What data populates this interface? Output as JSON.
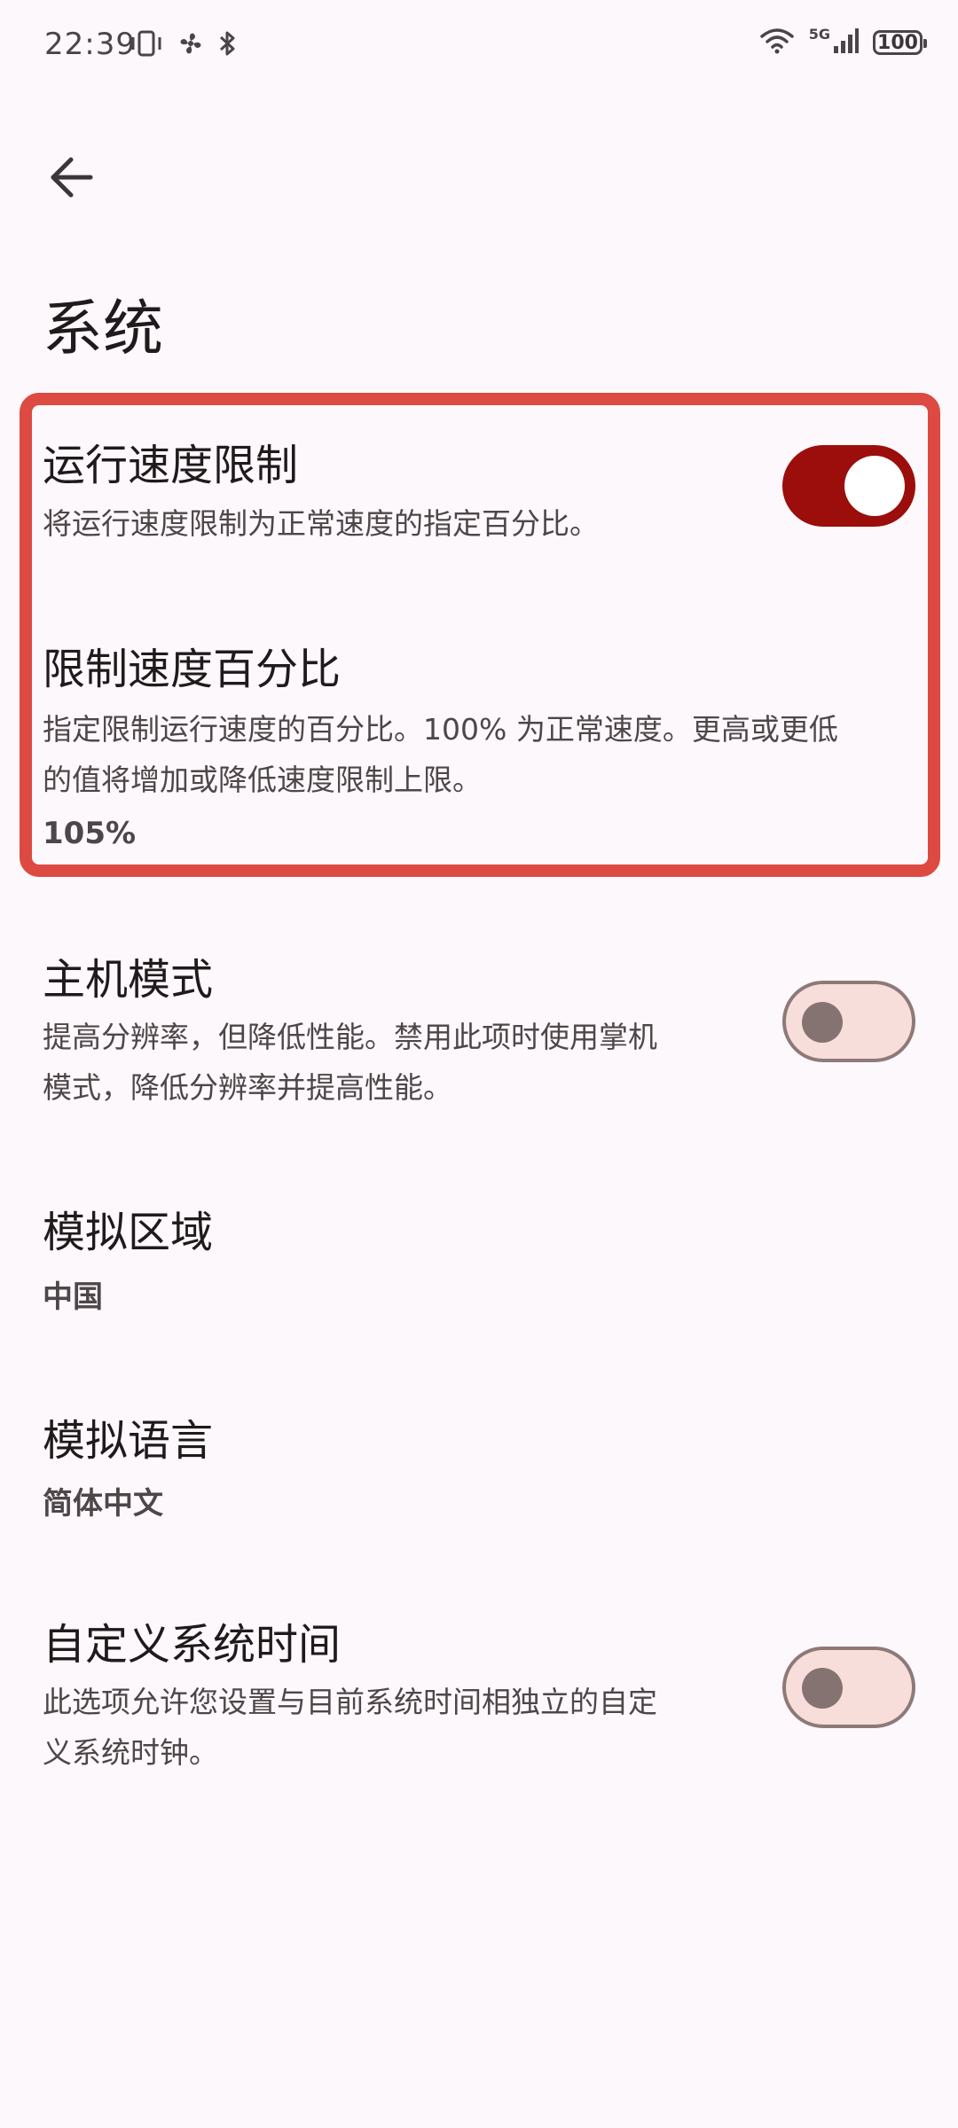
{
  "status_bar": {
    "time": "22:39",
    "network_label": "5G",
    "battery_level": "100",
    "left_icons": [
      "vibrate-icon",
      "fan-icon",
      "bluetooth-icon"
    ],
    "right_icons": [
      "wifi-icon",
      "signal-icon",
      "battery-icon"
    ]
  },
  "header": {
    "back_icon": "arrow-left-icon",
    "title": "系统"
  },
  "settings": {
    "speed_limit": {
      "title": "运行速度限制",
      "description": "将运行速度限制为正常速度的指定百分比。",
      "enabled": true
    },
    "speed_percent": {
      "title": "限制速度百分比",
      "description_line1": "指定限制运行速度的百分比。100% 为正常速度。更高或更低",
      "description_line2": "的值将增加或降低速度限制上限。",
      "value": "105%"
    },
    "docked_mode": {
      "title": "主机模式",
      "description_line1": "提高分辨率，但降低性能。禁用此项时使用掌机",
      "description_line2": "模式，降低分辨率并提高性能。",
      "enabled": false
    },
    "region": {
      "title": "模拟区域",
      "value": "中国"
    },
    "language": {
      "title": "模拟语言",
      "value": "简体中文"
    },
    "custom_rtc": {
      "title": "自定义系统时间",
      "description_line1": "此选项允许您设置与目前系统时间相独立的自定",
      "description_line2": "义系统时钟。",
      "enabled": false
    }
  },
  "colors": {
    "background": "#fcf8fb",
    "switch_on": "#9b0e0c",
    "switch_off_track": "#f8dedb",
    "highlight_border": "#dd4a42"
  }
}
